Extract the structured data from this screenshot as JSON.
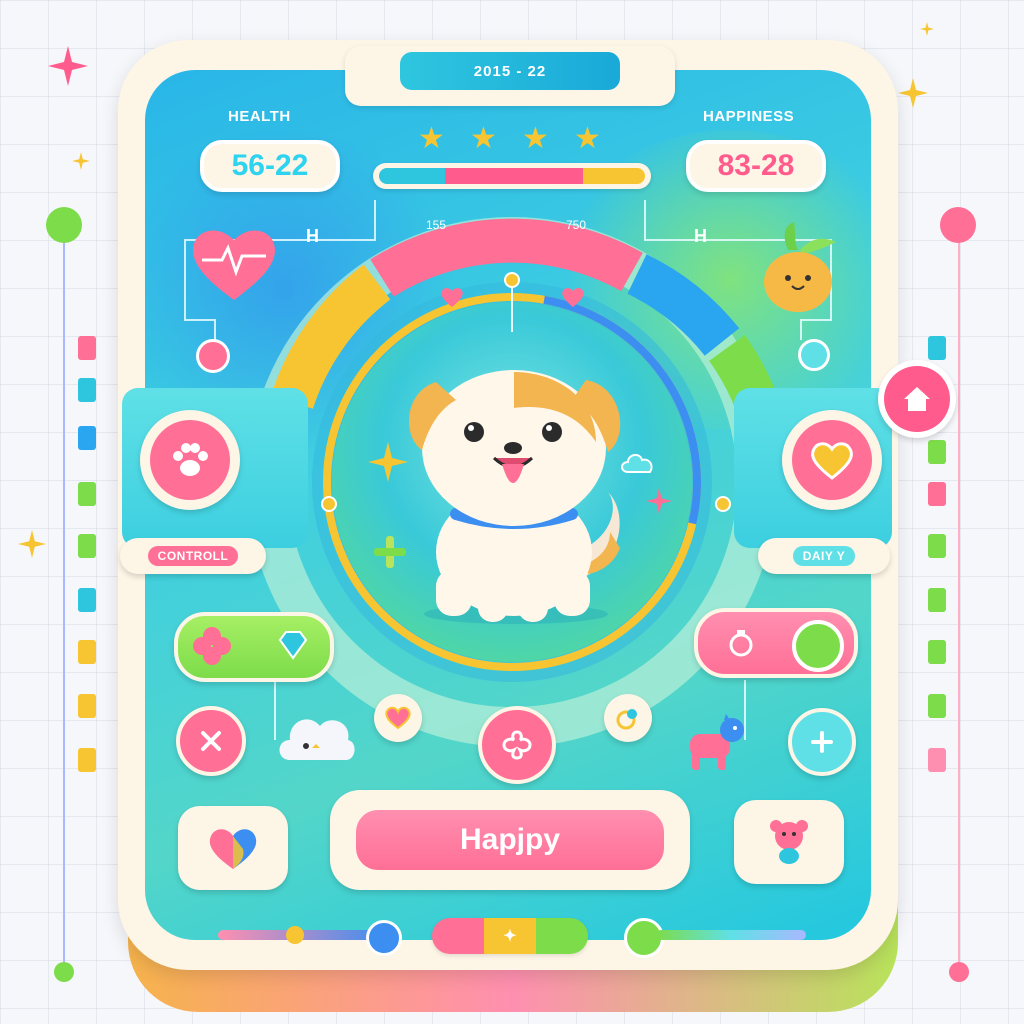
{
  "header": {
    "date": "2015 - 22"
  },
  "stats": {
    "health": {
      "label": "HEALTH",
      "value": "56-22",
      "color": "#2ed3f0"
    },
    "happiness": {
      "label": "HAPPINESS",
      "value": "83-28",
      "color": "#ff5c8d"
    }
  },
  "stars": [
    "★",
    "★",
    "★",
    "★"
  ],
  "ring": {
    "left_value": "155",
    "right_value": "750"
  },
  "side_marks": {
    "left": "H",
    "right": "H"
  },
  "side_panels": {
    "left": {
      "tag": "CONTROLL"
    },
    "right": {
      "tag": "DAIY Y"
    }
  },
  "actions": {
    "happy_label": "Hapjpy",
    "sparkle": "✦"
  },
  "icons": {
    "heart_monitor": "heart-pulse-icon",
    "pet": "dog-icon",
    "paw": "paw-icon",
    "home": "home-icon",
    "close": "close-icon"
  },
  "colors": {
    "pink": "#ff6f96",
    "cyan": "#2ec6df",
    "green": "#7ddc4a",
    "yellow": "#f7c531",
    "cream": "#fdf5e6"
  }
}
